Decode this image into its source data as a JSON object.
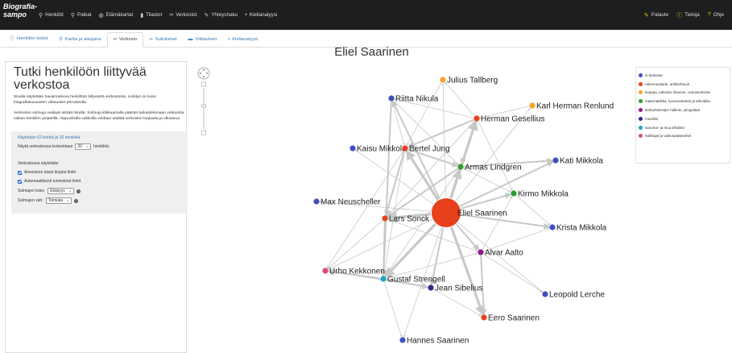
{
  "app": {
    "brand_line1": "Biografia-",
    "brand_line2": "sampo"
  },
  "nav": {
    "items": [
      {
        "label": "Henkilöt",
        "icon": "search-icon"
      },
      {
        "label": "Paikat",
        "icon": "search-icon"
      },
      {
        "label": "Elämäkartat",
        "icon": "globe-icon"
      },
      {
        "label": "Tilastot",
        "icon": "bar-chart-icon"
      },
      {
        "label": "Verkostot",
        "icon": "link-icon"
      },
      {
        "label": "Yhteyshaku",
        "icon": "pencil-icon"
      },
      {
        "label": "Kielianalyysi",
        "icon": "book-icon"
      }
    ],
    "right": [
      {
        "label": "Palaute",
        "icon": "pencil-icon"
      },
      {
        "label": "Tietoja",
        "icon": "info-icon"
      },
      {
        "label": "Ohje",
        "icon": "question-icon"
      }
    ]
  },
  "tabs": [
    {
      "label": "Henkilön tiedot",
      "icon": "info-icon",
      "active": false
    },
    {
      "label": "Kartta ja aikajana",
      "icon": "map-marker-icon",
      "active": false
    },
    {
      "label": "Verkosto",
      "icon": "link-icon",
      "active": true
    },
    {
      "label": "Sukulaiset",
      "icon": "link-icon",
      "active": false
    },
    {
      "label": "Viittaukset",
      "icon": "comment-icon",
      "active": false
    },
    {
      "label": "Kielianalyysi",
      "icon": "book-icon",
      "active": false
    }
  ],
  "person_title": "Eliel Saarinen",
  "panel": {
    "heading": "Tutki henkilöön liittyvää verkostoa",
    "desc1": "Sivulla näytetään havainnekuva henkilöön liittyvästä verkostosta. Linkitys on luotu biografiakuvausten viittausten perusteella.",
    "desc2": "Verkoston solmuja voidaan siirtää hiirellä. Solmuja klikkaamalla päästet tarkastelemaan verkostoa valitun henkilön ympärillä. Alapuolisilla valikoilla voidaan säätää verkoston laajuutta ja ulkoasua.",
    "summary": "Näytetään 52 linkkiä ja 20 henkilöä",
    "show_prefix": "Näytä verkostossa korkeintaan",
    "show_value": "20",
    "show_suffix": "henkilöä.",
    "network_shows": "Verkostossa näytetään",
    "chk1": "Aineistoon käsin kirjatut linkit",
    "chk2": "Automaattisesti tunnistetut linkit",
    "size_label": "Solmujen koko:",
    "size_value": "Etäisyys",
    "color_label": "Solmujen väri:",
    "color_value": "Toimiala"
  },
  "legend": [
    {
      "label": "ei tiedossa",
      "color": "#3f4fbf"
    },
    {
      "label": "rakennustaide, arkkitehtuuri",
      "color": "#e8401c"
    },
    {
      "label": "kauppa, palvelut, liikenne, osuustoiminta",
      "color": "#f5a623"
    },
    {
      "label": "matematiikka, luonnontieteet ja tekniikka",
      "color": "#2e9e2e"
    },
    {
      "label": "tiedeyhteisöjen hallinto, ylioppilaat",
      "color": "#8e1a8e"
    },
    {
      "label": "musiikki",
      "color": "#2a2a8a"
    },
    {
      "label": "sanoma- ja muu lehdistö",
      "color": "#1aa3c7"
    },
    {
      "label": "hallitsijat ja valtionpäämiehet",
      "color": "#d94a7a"
    }
  ],
  "network": {
    "nodes": [
      {
        "id": "eliel",
        "label": "Eliel Saarinen",
        "color": "#e8401c",
        "size": "large"
      },
      {
        "id": "tallberg",
        "label": "Julius Tallberg",
        "color": "#f5a623"
      },
      {
        "id": "nikula",
        "label": "Riitta Nikula",
        "color": "#3f4fbf"
      },
      {
        "id": "renlund",
        "label": "Karl Herman Renlund",
        "color": "#f5a623"
      },
      {
        "id": "gesellius",
        "label": "Herman Gesellius",
        "color": "#e8401c"
      },
      {
        "id": "kaisu",
        "label": "Kaisu Mikkola",
        "color": "#3f4fbf"
      },
      {
        "id": "jung",
        "label": "Bertel Jung",
        "color": "#e8401c"
      },
      {
        "id": "lindgren",
        "label": "Armas Lindgren",
        "color": "#2e9e2e"
      },
      {
        "id": "kati",
        "label": "Kati Mikkola",
        "color": "#3f4fbf"
      },
      {
        "id": "kirmo",
        "label": "Kirmo Mikkola",
        "color": "#2e9e2e"
      },
      {
        "id": "neuscheller",
        "label": "Max Neuscheller",
        "color": "#3f4fbf"
      },
      {
        "id": "sonck",
        "label": "Lars Sonck",
        "color": "#e8401c"
      },
      {
        "id": "krista",
        "label": "Krista Mikkola",
        "color": "#3f4fbf"
      },
      {
        "id": "aalto",
        "label": "Alvar Aalto",
        "color": "#8e1a8e"
      },
      {
        "id": "kekkonen",
        "label": "Urho Kekkonen",
        "color": "#d94a7a"
      },
      {
        "id": "strengell",
        "label": "Gustaf Strengell",
        "color": "#1aa3c7"
      },
      {
        "id": "sibelius",
        "label": "Jean Sibelius",
        "color": "#2a2a8a"
      },
      {
        "id": "lerche",
        "label": "Leopold Lerche",
        "color": "#3f4fbf"
      },
      {
        "id": "eero",
        "label": "Eero Saarinen",
        "color": "#e8401c"
      },
      {
        "id": "hannes",
        "label": "Hannes Saarinen",
        "color": "#3f4fbf"
      }
    ],
    "edges": [
      [
        "eliel",
        "tallberg",
        1
      ],
      [
        "eliel",
        "nikula",
        2
      ],
      [
        "eliel",
        "gesellius",
        3
      ],
      [
        "eliel",
        "jung",
        3
      ],
      [
        "eliel",
        "lindgren",
        3
      ],
      [
        "eliel",
        "kati",
        2
      ],
      [
        "eliel",
        "kirmo",
        2
      ],
      [
        "eliel",
        "sonck",
        3
      ],
      [
        "eliel",
        "krista",
        2
      ],
      [
        "eliel",
        "aalto",
        2
      ],
      [
        "eliel",
        "kekkonen",
        1
      ],
      [
        "eliel",
        "strengell",
        3
      ],
      [
        "eliel",
        "sibelius",
        2
      ],
      [
        "eliel",
        "eero",
        3
      ],
      [
        "eliel",
        "hannes",
        1
      ],
      [
        "eliel",
        "neuscheller",
        1
      ],
      [
        "eliel",
        "renlund",
        1
      ],
      [
        "eliel",
        "kaisu",
        1
      ],
      [
        "eliel",
        "lerche",
        1
      ],
      [
        "gesellius",
        "lindgren",
        2
      ],
      [
        "gesellius",
        "jung",
        2
      ],
      [
        "gesellius",
        "sonck",
        1
      ],
      [
        "gesellius",
        "tallberg",
        1
      ],
      [
        "gesellius",
        "nikula",
        1
      ],
      [
        "jung",
        "sonck",
        2
      ],
      [
        "jung",
        "lindgren",
        2
      ],
      [
        "jung",
        "strengell",
        1
      ],
      [
        "lindgren",
        "kati",
        2
      ],
      [
        "lindgren",
        "kirmo",
        1
      ],
      [
        "lindgren",
        "sonck",
        2
      ],
      [
        "lindgren",
        "strengell",
        1
      ],
      [
        "sonck",
        "strengell",
        2
      ],
      [
        "sonck",
        "kekkonen",
        1
      ],
      [
        "sonck",
        "aalto",
        1
      ],
      [
        "strengell",
        "sibelius",
        2
      ],
      [
        "strengell",
        "aalto",
        1
      ],
      [
        "strengell",
        "kekkonen",
        2
      ],
      [
        "strengell",
        "hannes",
        1
      ],
      [
        "aalto",
        "eero",
        2
      ],
      [
        "aalto",
        "krista",
        1
      ],
      [
        "aalto",
        "kirmo",
        1
      ],
      [
        "aalto",
        "lerche",
        1
      ],
      [
        "kirmo",
        "krista",
        1
      ],
      [
        "nikula",
        "lindgren",
        1
      ],
      [
        "tallberg",
        "jung",
        1
      ],
      [
        "renlund",
        "gesellius",
        1
      ],
      [
        "sibelius",
        "eero",
        1
      ],
      [
        "kekkonen",
        "sibelius",
        1
      ],
      [
        "nikula",
        "strengell",
        2
      ],
      [
        "jung",
        "kekkonen",
        1
      ],
      [
        "gesellius",
        "kirmo",
        1
      ],
      [
        "nikula",
        "jung",
        1
      ]
    ]
  }
}
